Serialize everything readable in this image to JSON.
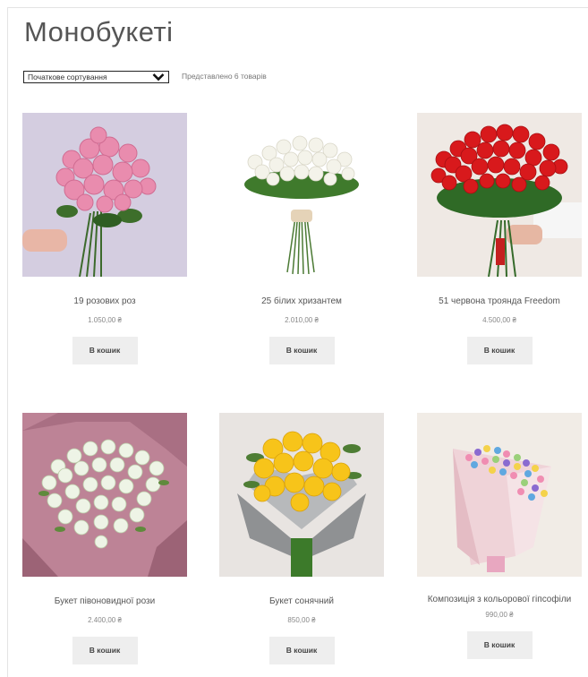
{
  "page": {
    "title": "Монобукеті",
    "sort": {
      "selected": "Початкове сортування"
    },
    "result_count": "Представлено 6 товарів"
  },
  "products": [
    {
      "name": "19 розових роз",
      "price": "1.050,00 ₴",
      "button": "В кошик",
      "image": "pink-roses-bouquet"
    },
    {
      "name": "25 білих хризантем",
      "price": "2.010,00 ₴",
      "button": "В кошик",
      "image": "white-chrysanthemums-bouquet"
    },
    {
      "name": "51 червона троянда Freedom",
      "price": "4.500,00 ₴",
      "button": "В кошик",
      "image": "red-roses-bouquet"
    },
    {
      "name": "Букет півоновидної рози",
      "price": "2.400,00 ₴",
      "button": "В кошик",
      "image": "white-spray-roses-bouquet"
    },
    {
      "name": "Букет сонячний",
      "price": "850,00 ₴",
      "button": "В кошик",
      "image": "yellow-roses-bouquet"
    },
    {
      "name": "Композиція з кольорової гіпсофіли",
      "price": "990,00 ₴",
      "button": "В кошик",
      "image": "colored-gypsophila-bouquet"
    }
  ]
}
